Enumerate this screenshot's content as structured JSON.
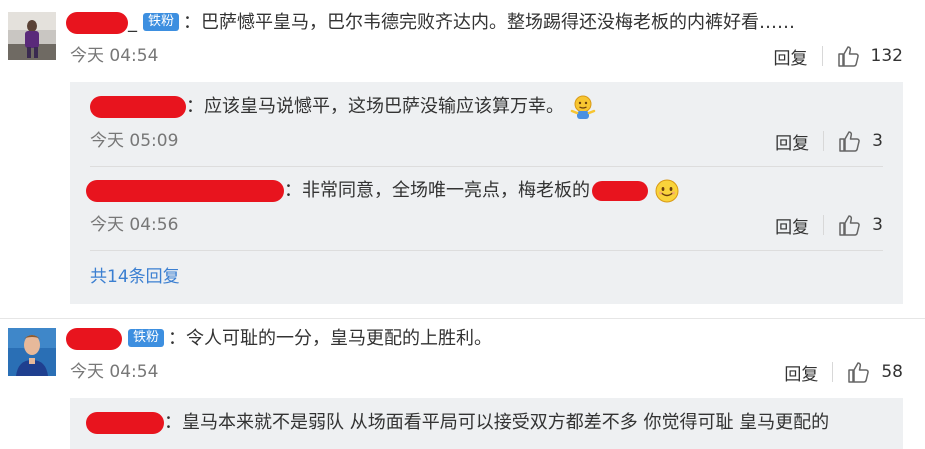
{
  "comments": [
    {
      "badge": "铁粉",
      "text": "：巴萨憾平皇马，巴尔韦德完败齐达内。整场踢得还没梅老板的内裤好看……",
      "time": "今天 04:54",
      "reply_label": "回复",
      "likes": "132",
      "replies": [
        {
          "text": "：应该皇马说憾平，这场巴萨没输应该算万幸。",
          "time": "今天 05:09",
          "reply_label": "回复",
          "likes": "3",
          "emoji": "shrug-emoji"
        },
        {
          "text": "：非常同意，全场唯一亮点，梅老板的",
          "time": "今天 04:56",
          "reply_label": "回复",
          "likes": "3",
          "emoji": "smile-emoji"
        }
      ],
      "more_replies": "共14条回复"
    },
    {
      "badge": "铁粉",
      "text": "：令人可耻的一分，皇马更配的上胜利。",
      "time": "今天 04:54",
      "reply_label": "回复",
      "likes": "58",
      "replies": [
        {
          "text": "：皇马本来就不是弱队  从场面看平局可以接受双方都差不多  你觉得可耻  皇马更配的"
        }
      ]
    }
  ],
  "colors": {
    "link": "#3b7fd1",
    "badge": "#3d8fe0",
    "redaction": "#e8141e",
    "reply_bg": "#eef0f2"
  }
}
